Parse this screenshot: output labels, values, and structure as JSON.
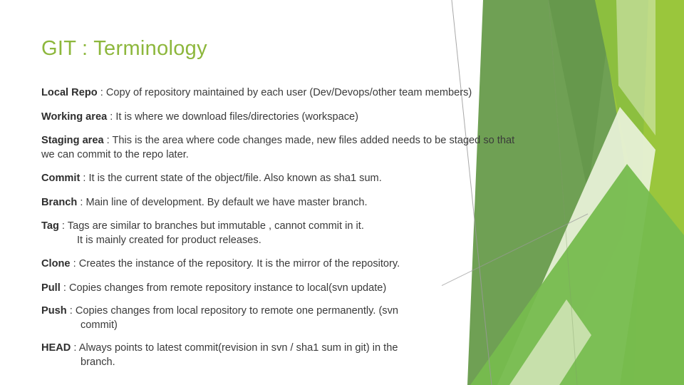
{
  "slide": {
    "title": "GIT : Terminology",
    "title_color": "#8DB73C",
    "background_color": "#FFFFFF",
    "text_color": "#3A3A3A"
  },
  "decor": {
    "colors": {
      "bright_green": "#9AC63C",
      "yellow_green": "#8CBF3F",
      "medium_green": "#76BC4E",
      "dark_green": "#6FA054",
      "deep_green": "#5E9245",
      "pale_green": "#D9E8C0",
      "very_pale_green": "#E9F2DA",
      "line_gray": "#9A9A9A"
    }
  },
  "terms": [
    {
      "term": "Local Repo",
      "separator": " : ",
      "definition": "Copy of repository maintained by each user (Dev/Devops/other team members)",
      "continuation": ""
    },
    {
      "term": "Working area",
      "separator": " : ",
      "definition": "It is where we download files/directories (workspace)",
      "continuation": ""
    },
    {
      "term": "Staging area",
      "separator": " :  ",
      "definition": "This is the area where code changes made, new files added needs to be staged so that we can commit to the repo later.",
      "continuation": ""
    },
    {
      "term": "Commit",
      "separator": " : ",
      "definition": "It is the current state of the object/file. Also known as sha1 sum.",
      "continuation": ""
    },
    {
      "term": "Branch",
      "separator": " : ",
      "definition": "Main line of development. By default we have master branch.",
      "continuation": ""
    },
    {
      "term": "Tag",
      "separator": " : ",
      "definition": "Tags are similar to branches but immutable , cannot commit in it.",
      "continuation": "It is mainly created for product releases."
    },
    {
      "term": "Clone",
      "separator": " : ",
      "definition": "Creates the instance of the repository. It is the mirror of the repository.",
      "continuation": ""
    },
    {
      "term": "Pull",
      "separator": " : ",
      "definition": "Copies changes from remote repository instance to local(svn update)",
      "continuation": ""
    },
    {
      "term": "Push",
      "separator": " : ",
      "definition": "Copies changes from local repository to remote one permanently. (svn",
      "continuation": "commit)"
    },
    {
      "term": "HEAD",
      "separator": " : ",
      "definition": "Always points to latest commit(revision in svn / sha1 sum in git) in the",
      "continuation": "branch."
    }
  ]
}
